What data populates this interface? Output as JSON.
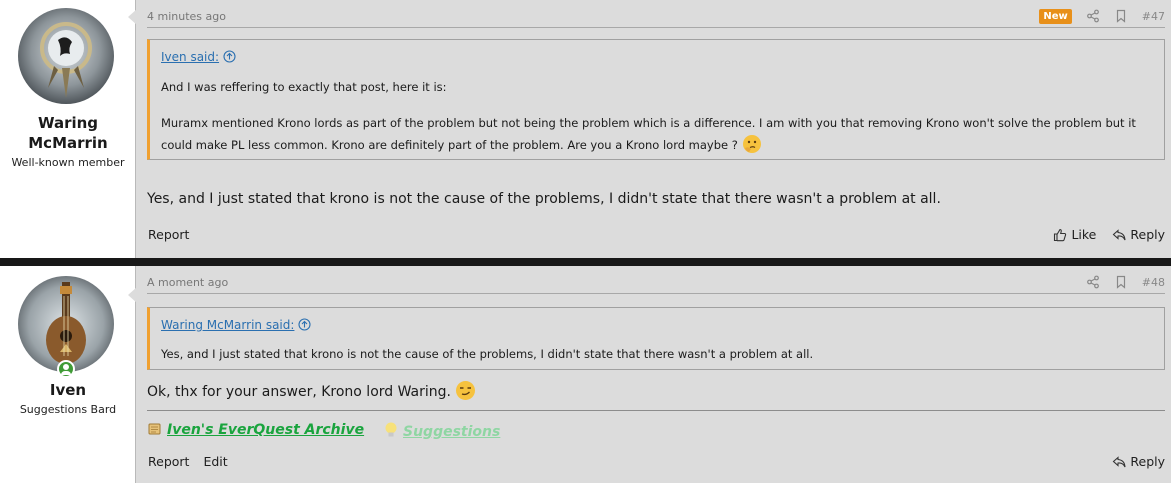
{
  "posts": [
    {
      "user": {
        "name_line1": "Waring",
        "name_line2": "McMarrin",
        "title": "Well-known member"
      },
      "time": "4 minutes ago",
      "badge": "New",
      "number": "#47",
      "quote": {
        "author": "Iven said:",
        "line1": "And I was reffering to exactly that post, here it is:",
        "line2": "Muramx mentioned Krono lords as part of the problem but not being the problem which is a difference. I am with you that removing Krono won't solve the problem but it",
        "line3": "could make PL less common. Krono are definitely part of the problem. Are you a Krono lord maybe ?"
      },
      "body": "Yes, and I just stated that krono is not the cause of the problems, I didn't state that there wasn't a problem at all.",
      "actions": {
        "report": "Report",
        "like": "Like",
        "reply": "Reply"
      }
    },
    {
      "user": {
        "name": "Iven",
        "title": "Suggestions Bard"
      },
      "time": "A moment ago",
      "number": "#48",
      "quote": {
        "author": "Waring McMarrin said:",
        "line1": "Yes, and I just stated that krono is not the cause of the problems, I didn't state that there wasn't a problem at all."
      },
      "body": "Ok, thx for your answer, Krono lord Waring.",
      "signature": {
        "link1": "Iven's EverQuest Archive",
        "link2": "Suggestions"
      },
      "actions": {
        "report": "Report",
        "edit": "Edit",
        "reply": "Reply"
      }
    }
  ],
  "colors": {
    "accent_new": "#e8901a",
    "quote_border": "#f0a030",
    "link": "#2a6fb0",
    "sig_link1": "#1aa43e",
    "sig_link2": "#8fd6a3",
    "online": "#3f9b36"
  },
  "icons": [
    "share-icon",
    "bookmark-icon",
    "arrow-up-circle-icon",
    "thumbs-up-icon",
    "reply-icon",
    "thinking-emoji-icon",
    "smirk-emoji-icon",
    "scroll-icon",
    "lightbulb-icon"
  ]
}
